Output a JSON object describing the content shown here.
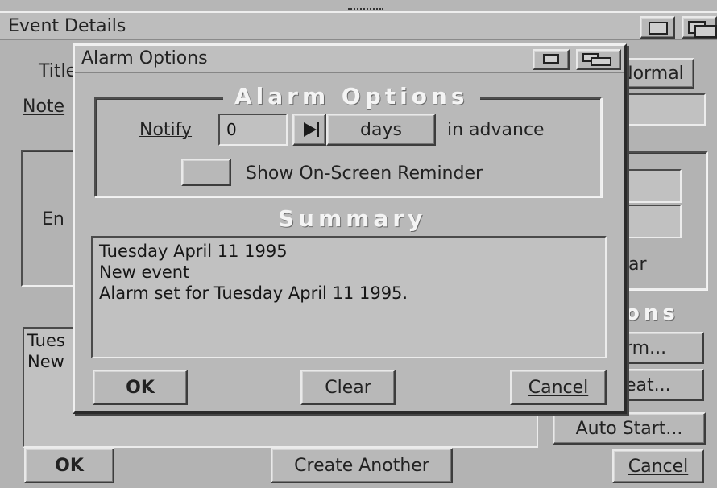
{
  "event_window": {
    "title": "Event Details",
    "title_label": "Title",
    "notes_label": "Note",
    "normal_button": "Normal",
    "end_label": "En",
    "calendar_fragment": "ar",
    "options_fragment": "ons",
    "list_items": [
      "Tues",
      "New"
    ],
    "alarm_button_fragment": "rm...",
    "repeat_button_fragment": "eat...",
    "auto_start_button": "Auto Start...",
    "ok_button": "OK",
    "create_another_button": "Create Another",
    "cancel_button": "Cancel"
  },
  "alarm_dialog": {
    "title": "Alarm Options",
    "options_group_title": "Alarm Options",
    "notify_label": "Notify",
    "notify_value": "0",
    "unit_value": "days",
    "in_advance_label": "in advance",
    "show_reminder_label": "Show On-Screen Reminder",
    "show_reminder_checked": false,
    "summary_title": "Summary",
    "summary_lines": [
      "Tuesday April 11 1995",
      "New event",
      "Alarm set for Tuesday April 11 1995."
    ],
    "ok_button": "OK",
    "clear_button": "Clear",
    "cancel_button": "Cancel"
  },
  "icons": {
    "iconify": "iconify-icon",
    "maximize": "maximize-icon",
    "play": "play-triangle-icon"
  }
}
